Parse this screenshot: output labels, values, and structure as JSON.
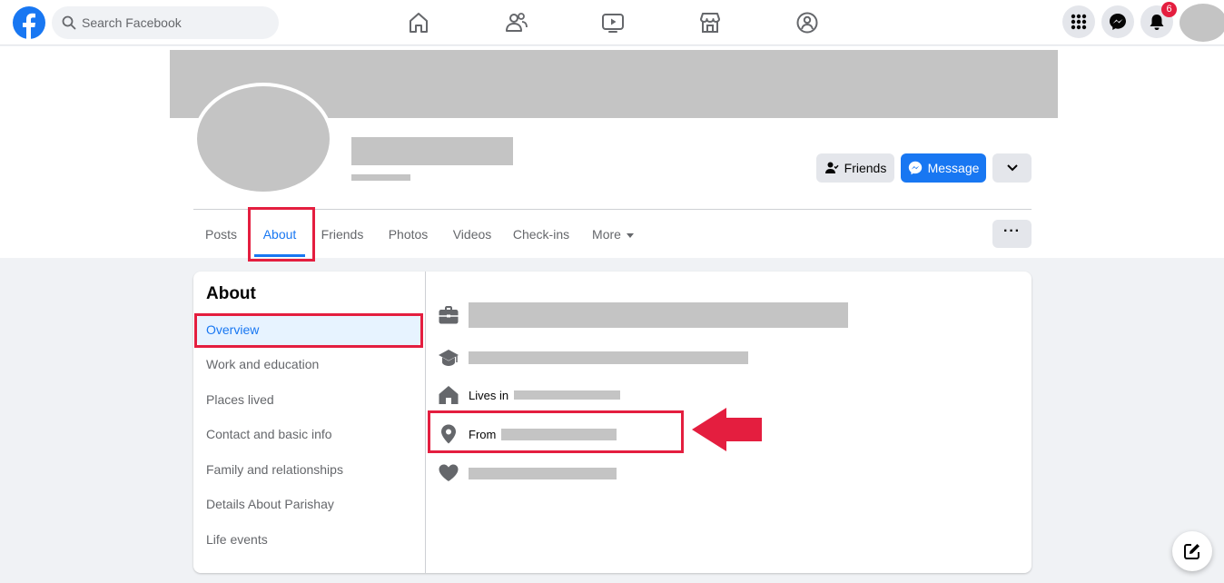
{
  "header": {
    "search_placeholder": "Search Facebook",
    "notification_count": "6",
    "nav_icons": [
      "home-icon",
      "friends-icon",
      "watch-icon",
      "marketplace-icon",
      "groups-icon"
    ],
    "right_icons": [
      "menu-grid-icon",
      "messenger-icon",
      "bell-icon"
    ]
  },
  "profile": {
    "actions": {
      "friends_label": "Friends",
      "message_label": "Message",
      "more_label": "▾"
    },
    "tabs": [
      {
        "label": "Posts"
      },
      {
        "label": "About",
        "active": true
      },
      {
        "label": "Friends"
      },
      {
        "label": "Photos"
      },
      {
        "label": "Videos"
      },
      {
        "label": "Check-ins"
      },
      {
        "label": "More"
      }
    ],
    "dots_label": "···"
  },
  "about": {
    "title": "About",
    "sections": [
      {
        "label": "Overview",
        "active": true
      },
      {
        "label": "Work and education"
      },
      {
        "label": "Places lived"
      },
      {
        "label": "Contact and basic info"
      },
      {
        "label": "Family and relationships"
      },
      {
        "label": "Details About Parishay"
      },
      {
        "label": "Life events"
      }
    ],
    "overview": [
      {
        "icon": "briefcase-icon",
        "label": ""
      },
      {
        "icon": "graduation-cap-icon",
        "label": ""
      },
      {
        "icon": "home-icon",
        "label": "Lives in"
      },
      {
        "icon": "location-pin-icon",
        "label": "From"
      },
      {
        "icon": "heart-icon",
        "label": ""
      }
    ]
  },
  "colors": {
    "brand_blue": "#1877f2",
    "highlight_red": "#e41e3f",
    "placeholder_grey": "#c4c4c4"
  }
}
